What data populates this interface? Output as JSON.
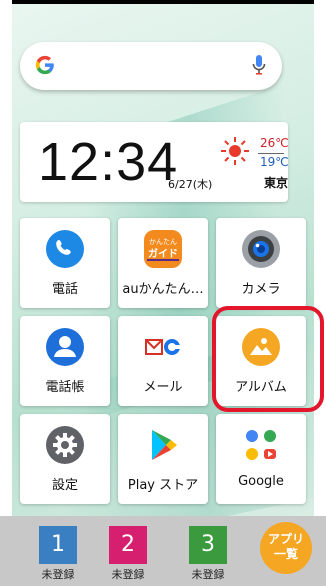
{
  "clock": {
    "time": "12:34",
    "date": "6/27(木)",
    "temp_high": "26℃",
    "temp_low": "19℃",
    "city": "東京"
  },
  "tiles": [
    {
      "label": "電話",
      "icon": "phone-icon"
    },
    {
      "label": "auかんたん…",
      "icon": "au-kantan-guide-icon",
      "icon_text_1": "かんたん",
      "icon_text_2": "ガイド"
    },
    {
      "label": "カメラ",
      "icon": "camera-icon"
    },
    {
      "label": "電話帳",
      "icon": "contacts-icon"
    },
    {
      "label": "メール",
      "icon": "mail-icon"
    },
    {
      "label": "アルバム",
      "icon": "album-icon"
    },
    {
      "label": "設定",
      "icon": "settings-icon"
    },
    {
      "label": "Play ストア",
      "icon": "play-store-icon"
    },
    {
      "label": "Google",
      "icon": "google-apps-icon"
    }
  ],
  "dock": [
    {
      "number": "1",
      "label": "未登録",
      "color": "#3a7fc1"
    },
    {
      "number": "2",
      "label": "未登録",
      "color": "#d6206f"
    },
    {
      "number": "3",
      "label": "未登録",
      "color": "#3b9a3e"
    }
  ],
  "apps_button": {
    "line1": "アプリ",
    "line2": "一覧",
    "color": "#f5a623"
  },
  "colors": {
    "highlight": "#e3162b",
    "accent_orange": "#f5a623"
  }
}
